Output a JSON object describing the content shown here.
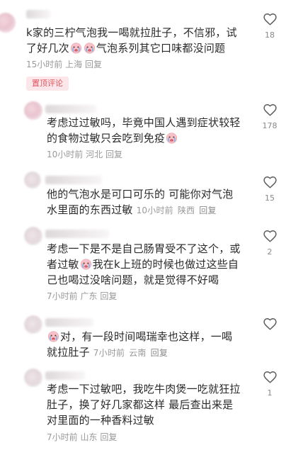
{
  "badge_label": "置顶评论",
  "emoji_name": "face-with-tears-emoji",
  "comments": [
    {
      "lines": [
        "k家的三柠气泡我一喝就拉肚子，不信邪，试",
        "了好几次",
        "气泡系列其它口味都没问题"
      ],
      "time": "15小时前",
      "region": "上海",
      "reply": "回复",
      "likes": "18"
    },
    {
      "lines": [
        "考虑过过敏吗，毕竟中国人遇到症状较轻",
        "的食物过敏只会吃到免疫"
      ],
      "time": "10小时前",
      "region": "河北",
      "reply": "回复",
      "likes": "178"
    },
    {
      "lines": [
        "他的气泡水是可口可乐的 可能你对气泡",
        "水里面的东西过敏"
      ],
      "time": "10小时前",
      "region": "陕西",
      "reply": "回复",
      "likes": "15"
    },
    {
      "lines": [
        "考虑一下是不是自己肠胃受不了这个，或",
        "者过敏",
        "我在k上班的时候也做过这些自",
        "己也喝过没啥问题，就是觉得不好喝"
      ],
      "time": "7小时前",
      "region": "广东",
      "reply": "回复",
      "likes": "2"
    },
    {
      "lines": [
        "对，有一段时间喝瑞幸也这样，一喝",
        "就拉肚子"
      ],
      "time": "7小时前",
      "region": "云南",
      "reply": "回复",
      "likes": ""
    },
    {
      "lines": [
        "考虑一下过敏吧，我吃牛肉煲一吃就狂拉",
        "肚子，换了好几家都这样 最后查出来是",
        "对里面的一种香料过敏"
      ],
      "time": "7小时前",
      "region": "山东",
      "reply": "回复",
      "likes": "1"
    }
  ]
}
